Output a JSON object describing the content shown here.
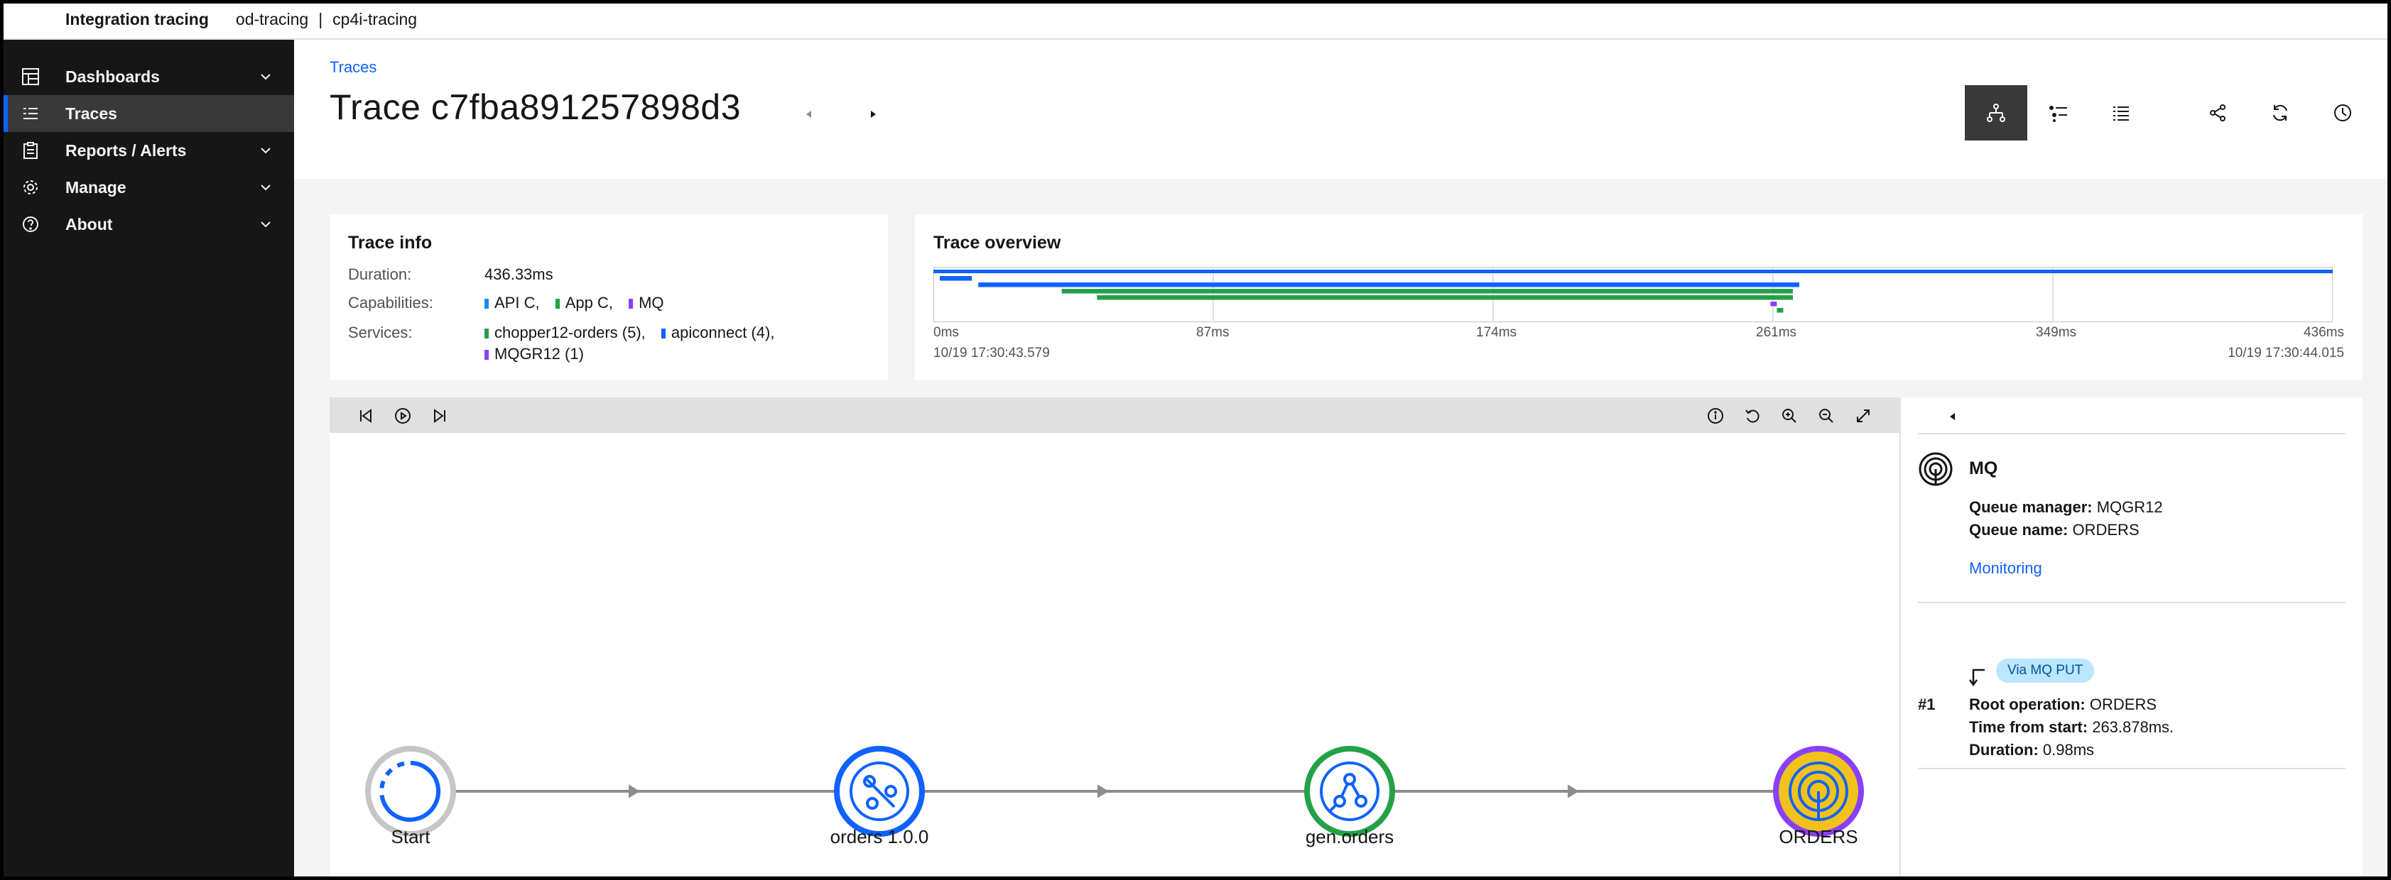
{
  "header": {
    "app_title": "Integration tracing",
    "context_primary": "od-tracing",
    "context_separator": "|",
    "context_secondary": "cp4i-tracing"
  },
  "sidebar": {
    "items": [
      {
        "label": "Dashboards",
        "icon": "dashboard-icon",
        "expandable": true
      },
      {
        "label": "Traces",
        "icon": "list-icon",
        "active": true
      },
      {
        "label": "Reports / Alerts",
        "icon": "report-icon",
        "expandable": true
      },
      {
        "label": "Manage",
        "icon": "gear-icon",
        "expandable": true
      },
      {
        "label": "About",
        "icon": "help-icon",
        "expandable": true
      }
    ]
  },
  "page": {
    "breadcrumb": "Traces",
    "title": "Trace c7fba891257898d3"
  },
  "toolbar": {
    "icons": [
      "topology-view-icon",
      "tree-list-icon",
      "list-view-icon",
      "share-icon",
      "refresh-icon",
      "time-icon"
    ],
    "selected": "topology-view-icon"
  },
  "trace_info": {
    "title": "Trace info",
    "duration_label": "Duration:",
    "duration": "436.33ms",
    "capabilities_label": "Capabilities:",
    "capabilities": [
      {
        "name": "API C,",
        "color": "#1192e8"
      },
      {
        "name": "App C,",
        "color": "#24a148"
      },
      {
        "name": "MQ",
        "color": "#8a3ffc"
      }
    ],
    "services_label": "Services:",
    "services": [
      {
        "name": "chopper12-orders (5),",
        "color": "#24a148"
      },
      {
        "name": "apiconnect (4),",
        "color": "#0f62fe"
      },
      {
        "name": "MQGR12 (1)",
        "color": "#8a3ffc"
      }
    ]
  },
  "trace_overview": {
    "title": "Trace overview",
    "ticks": [
      "0ms",
      "87ms",
      "174ms",
      "261ms",
      "349ms",
      "436ms"
    ],
    "start_time": "10/19 17:30:43.579",
    "end_time": "10/19 17:30:44.015",
    "max_ms": 436.33,
    "spans": [
      {
        "start": 0,
        "end": 436.33,
        "color": "#0f62fe"
      },
      {
        "start": 2,
        "end": 12,
        "color": "#0f62fe"
      },
      {
        "start": 14,
        "end": 270,
        "color": "#0f62fe"
      },
      {
        "start": 40,
        "end": 268,
        "color": "#24a148"
      },
      {
        "start": 51,
        "end": 268,
        "color": "#24a148"
      },
      {
        "start": 261,
        "end": 263,
        "color": "#8a3ffc"
      },
      {
        "start": 263,
        "end": 265,
        "color": "#24a148"
      }
    ]
  },
  "graph": {
    "nodes": [
      {
        "label": "Start",
        "ring": "#c6c6c6",
        "fill": "#ffffff",
        "icon": "start-icon"
      },
      {
        "label": "orders 1.0.0",
        "ring": "#0f62fe",
        "fill": "#ffffff",
        "icon": "api-icon"
      },
      {
        "label": "gen.orders",
        "ring": "#24a148",
        "fill": "#ffffff",
        "icon": "flow-icon"
      },
      {
        "label": "ORDERS",
        "ring": "#8a3ffc",
        "fill": "#f1c21b",
        "icon": "mq-queue-icon"
      }
    ],
    "controls_left": [
      "skip-back-icon",
      "play-icon",
      "skip-forward-icon"
    ],
    "controls_right": [
      "info-icon",
      "reset-icon",
      "zoom-in-icon",
      "zoom-out-icon",
      "fit-screen-icon"
    ]
  },
  "details": {
    "title": "MQ",
    "queue_manager_label": "Queue manager:",
    "queue_manager": "MQGR12",
    "queue_name_label": "Queue name:",
    "queue_name": "ORDERS",
    "monitoring_link": "Monitoring",
    "badge": "Via MQ PUT",
    "index": "#1",
    "root_op_label": "Root operation:",
    "root_op": "ORDERS",
    "time_from_start_label": "Time from start:",
    "time_from_start": "263.878ms.",
    "duration_label": "Duration:",
    "duration": "0.98ms"
  }
}
